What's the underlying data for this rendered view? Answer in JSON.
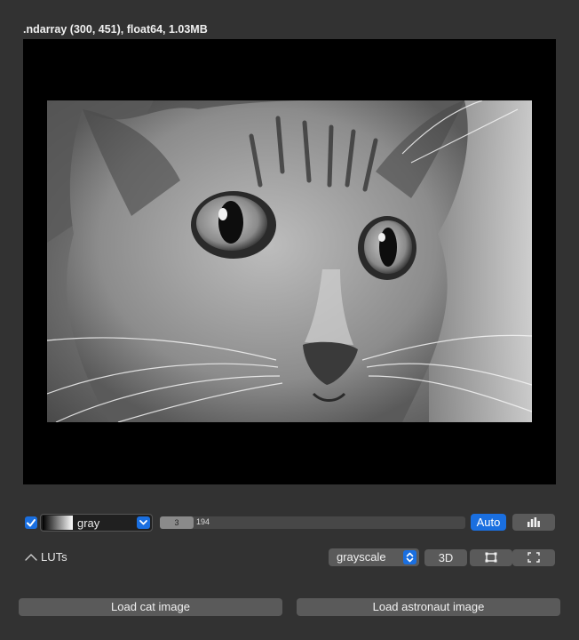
{
  "viewer": {
    "info_label": ".ndarray (300, 451), float64, 1.03MB"
  },
  "channel": {
    "visible": true,
    "lut_name": "gray",
    "range_min": "3",
    "range_max": "194",
    "auto_label": "Auto"
  },
  "luts_row": {
    "toggle_label": "LUTs",
    "mode_value": "grayscale",
    "btn_3d_label": "3D"
  },
  "actions": {
    "load_cat_label": "Load cat image",
    "load_astronaut_label": "Load astronaut image"
  },
  "colors": {
    "accent": "#1a6fe0",
    "background": "#323232",
    "button": "#5a5a5a",
    "canvas": "#000000"
  }
}
